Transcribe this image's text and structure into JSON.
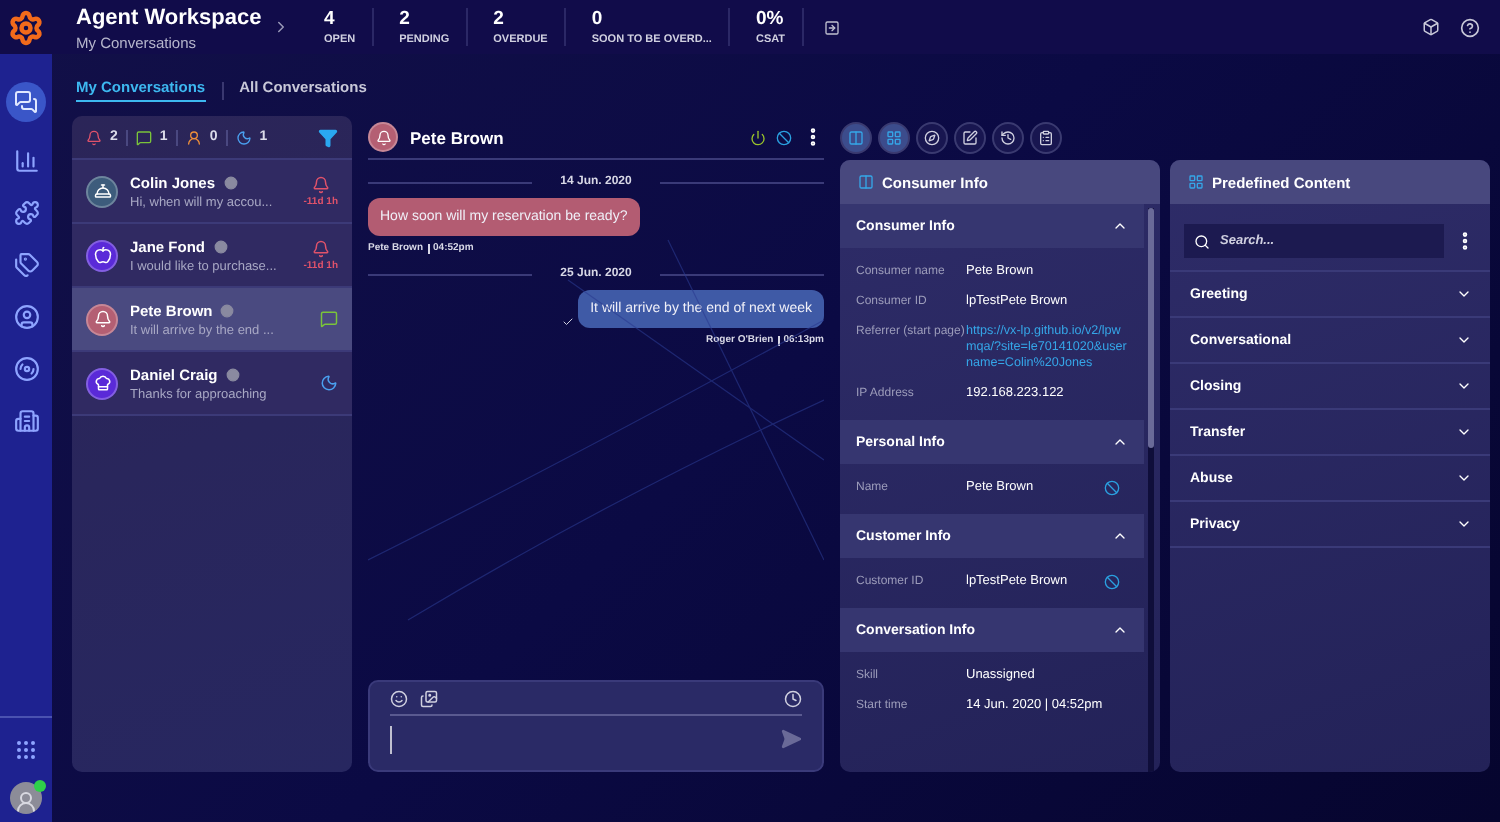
{
  "header": {
    "title": "Agent Workspace",
    "subtitle": "My Conversations",
    "stats": [
      {
        "value": "4",
        "label": "OPEN"
      },
      {
        "value": "2",
        "label": "PENDING"
      },
      {
        "value": "2",
        "label": "OVERDUE"
      },
      {
        "value": "0",
        "label": "SOON TO BE OVERD..."
      },
      {
        "value": "0%",
        "label": "CSAT"
      }
    ]
  },
  "tabs": [
    {
      "label": "My Conversations",
      "selected": true
    },
    {
      "label": "All Conversations",
      "selected": false
    }
  ],
  "counters": [
    {
      "kind": "alert",
      "value": "2"
    },
    {
      "kind": "message",
      "value": "1"
    },
    {
      "kind": "agent",
      "value": "0"
    },
    {
      "kind": "sleep",
      "value": "1"
    }
  ],
  "conversations": [
    {
      "name": "Colin Jones",
      "preview": "Hi, when will my accou...",
      "avatar": {
        "kind": "dome",
        "color": "#3d5c7c"
      },
      "status": {
        "kind": "alert",
        "time": "-11d 1h"
      },
      "selected": false
    },
    {
      "name": "Jane Fond",
      "preview": "I would like to purchase...",
      "avatar": {
        "kind": "apple",
        "color": "#5a2ad8"
      },
      "status": {
        "kind": "alert",
        "time": "-11d 1h"
      },
      "selected": false
    },
    {
      "name": "Pete Brown",
      "preview": "It will arrive by the end ...",
      "avatar": {
        "kind": "bell",
        "color": "#b45f73"
      },
      "status": {
        "kind": "message"
      },
      "selected": true
    },
    {
      "name": "Daniel Craig",
      "preview": "Thanks for approaching",
      "avatar": {
        "kind": "chef",
        "color": "#5a2ad8"
      },
      "status": {
        "kind": "sleep"
      },
      "selected": false
    }
  ],
  "chat": {
    "name": "Pete Brown",
    "avatar": {
      "kind": "bell",
      "color": "#b45f73"
    },
    "messages": [
      {
        "kind": "date",
        "text": "14 Jun. 2020"
      },
      {
        "kind": "incoming",
        "text": "How soon will my reservation be ready?",
        "author": "Pete Brown",
        "time": "04:52pm"
      },
      {
        "kind": "date",
        "text": "25 Jun. 2020"
      },
      {
        "kind": "outgoing",
        "text": "It will arrive by the end of next week",
        "author": "Roger O'Brien",
        "time": "06:13pm"
      }
    ]
  },
  "tools": [
    {
      "kind": "columns",
      "selected": true
    },
    {
      "kind": "grid",
      "selected": true
    },
    {
      "kind": "compass",
      "selected": false
    },
    {
      "kind": "edit",
      "selected": false
    },
    {
      "kind": "history",
      "selected": false
    },
    {
      "kind": "clipboard",
      "selected": false
    }
  ],
  "consumer_panel": {
    "title": "Consumer Info",
    "sections": [
      {
        "title": "Consumer Info",
        "expanded": true,
        "fields": [
          {
            "label": "Consumer name",
            "value": "Pete Brown",
            "kind": "text",
            "verified": false
          },
          {
            "label": "Consumer ID",
            "value": "lpTestPete Brown",
            "kind": "text",
            "verified": false
          },
          {
            "label": "Referrer (start page)",
            "value": "https://vx-lp.github.io/v2/lpwmqa/?site=le70141020&username=Colin%20Jones",
            "kind": "link",
            "verified": false
          },
          {
            "label": "IP Address",
            "value": "192.168.223.122",
            "kind": "text",
            "verified": false
          }
        ]
      },
      {
        "title": "Personal Info",
        "expanded": true,
        "fields": [
          {
            "label": "Name",
            "value": "Pete Brown",
            "kind": "text",
            "verified": true
          }
        ]
      },
      {
        "title": "Customer Info",
        "expanded": true,
        "fields": [
          {
            "label": "Customer ID",
            "value": "lpTestPete Brown",
            "kind": "text",
            "verified": true
          }
        ]
      },
      {
        "title": "Conversation Info",
        "expanded": true,
        "fields": [
          {
            "label": "Skill",
            "value": "Unassigned",
            "kind": "text",
            "verified": false
          },
          {
            "label": "Start time",
            "value": "14 Jun. 2020 | 04:52pm",
            "kind": "text",
            "verified": false
          }
        ]
      }
    ]
  },
  "predefined": {
    "title": "Predefined Content",
    "search_placeholder": "Search...",
    "categories": [
      {
        "label": "Greeting",
        "expanded": false
      },
      {
        "label": "Conversational",
        "expanded": false
      },
      {
        "label": "Closing",
        "expanded": false
      },
      {
        "label": "Transfer",
        "expanded": false
      },
      {
        "label": "Abuse",
        "expanded": false
      },
      {
        "label": "Privacy",
        "expanded": false
      }
    ]
  }
}
